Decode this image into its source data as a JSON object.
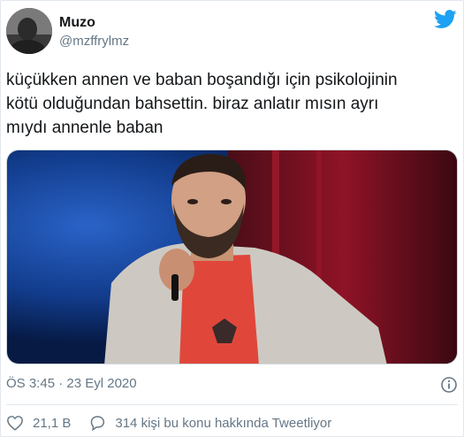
{
  "author": {
    "name": "Muzo",
    "handle": "@mzffrylmz"
  },
  "tweet": {
    "lines": [
      "küçükken annen ve baban boşandığı için psikolojinin",
      "kötü olduğundan bahsettin. biraz anlatır mısın ayrı",
      "mıydı annenle baban"
    ],
    "timestamp": "ÖS 3:45 · 23 Eyl 2020"
  },
  "actions": {
    "likes": "21,1 B",
    "conversation": "314 kişi bu konu hakkında Tweetliyor"
  },
  "icons": {
    "brand": "twitter-bird-icon",
    "info": "info-icon",
    "like": "heart-icon",
    "reply": "speech-bubble-icon"
  },
  "colors": {
    "brand": "#1da1f2",
    "text": "#14171a",
    "secondary": "#657786",
    "divider": "#e1e8ed"
  }
}
